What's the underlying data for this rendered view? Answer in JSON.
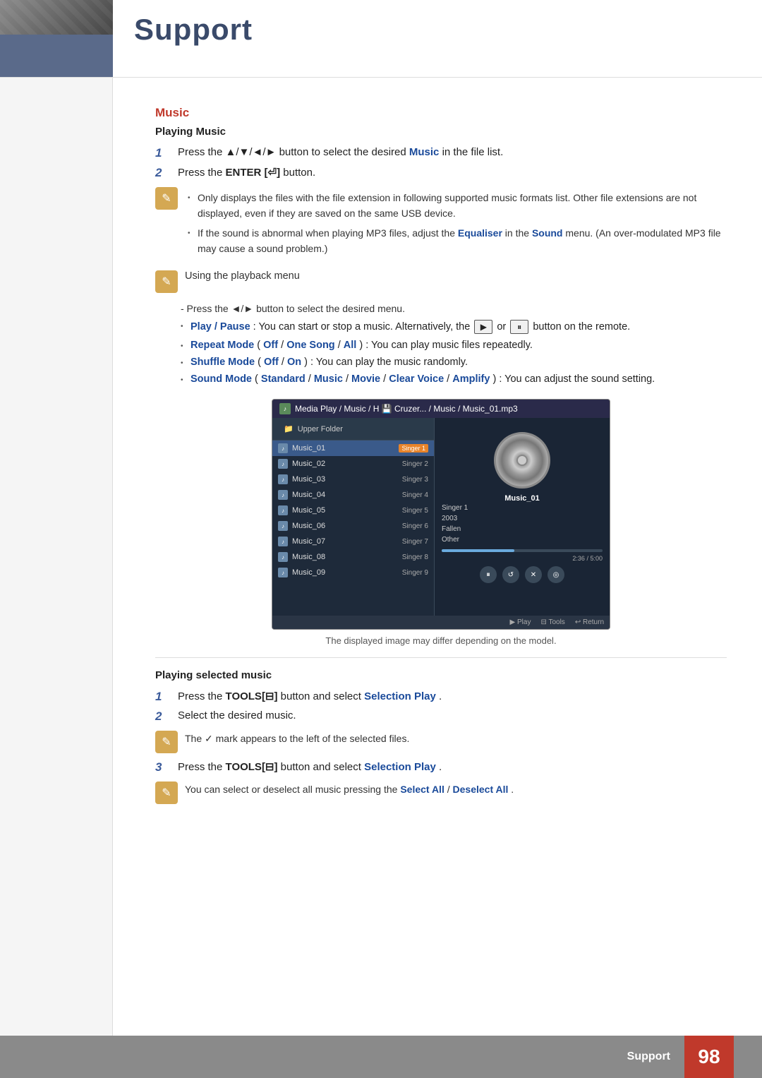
{
  "header": {
    "title": "Support"
  },
  "section": {
    "heading": "Music",
    "playing_music_heading": "Playing Music",
    "step1": "Press the ▲/▼/◄/► button to select the desired",
    "step1_bold": "Music",
    "step1_end": "in the file list.",
    "step2_start": "Press the",
    "step2_bold": "ENTER",
    "step2_end": "button.",
    "note1_bullet1": "Only displays the files with the file extension in following supported music formats list. Other file extensions are not displayed, even if they are saved on the same USB device.",
    "note1_bullet2_start": "If the sound is abnormal when playing MP3 files, adjust the",
    "note1_bullet2_eq": "Equaliser",
    "note1_bullet2_mid": "in the",
    "note1_bullet2_sound": "Sound",
    "note1_bullet2_end": "menu. (An over-modulated MP3 file may cause a sound problem.)",
    "playback_menu_label": "Using the playback menu",
    "press_lr_note": "- Press the ◄/► button to select the desired menu.",
    "play_pause_start": "Play / Pause",
    "play_pause_desc": ": You can start or stop a music. Alternatively, the",
    "play_pause_or": "or",
    "play_pause_end": "button on the remote.",
    "repeat_mode": "Repeat Mode",
    "repeat_off": "Off",
    "repeat_one": "One Song",
    "repeat_all": "All",
    "repeat_desc": ": You can play music files repeatedly.",
    "shuffle_mode": "Shuffle Mode",
    "shuffle_off": "Off",
    "shuffle_on": "On",
    "shuffle_desc": ": You can play the music randomly.",
    "sound_mode": "Sound Mode",
    "sound_standard": "Standard",
    "sound_music": "Music",
    "sound_movie": "Movie",
    "sound_clear": "Clear Voice",
    "sound_amplify": "Amplify",
    "sound_desc": ": You can adjust the sound setting.",
    "screenshot_titlebar": "Media Play / Music / H",
    "screenshot_titlebar2": "Cruzer... / Music / Music_01.mp3",
    "upper_folder": "Upper Folder",
    "files": [
      {
        "name": "Music_01",
        "singer": "Singer 1",
        "selected": true
      },
      {
        "name": "Music_02",
        "singer": "Singer 2",
        "selected": false
      },
      {
        "name": "Music_03",
        "singer": "Singer 3",
        "selected": false
      },
      {
        "name": "Music_04",
        "singer": "Singer 4",
        "selected": false
      },
      {
        "name": "Music_05",
        "singer": "Singer 5",
        "selected": false
      },
      {
        "name": "Music_06",
        "singer": "Singer 6",
        "selected": false
      },
      {
        "name": "Music_07",
        "singer": "Singer 7",
        "selected": false
      },
      {
        "name": "Music_08",
        "singer": "Singer 8",
        "selected": false
      },
      {
        "name": "Music_09",
        "singer": "Singer 9",
        "selected": false
      }
    ],
    "track_name": "Music_01",
    "track_singer": "Singer 1",
    "track_year": "2003",
    "track_album": "Fallen",
    "track_genre": "Other",
    "time_current": "2:36",
    "time_total": "5:00",
    "footer_play": "Play",
    "footer_tools": "Tools",
    "footer_return": "Return",
    "caption": "The displayed image may differ depending on the model.",
    "playing_selected_heading": "Playing selected music",
    "sel_step1_start": "Press the",
    "sel_step1_bold": "TOOLS[",
    "sel_step1_mid": "]",
    "sel_step1_end": "button and select",
    "sel_step1_select": "Selection Play",
    "sel_step1_dot": ".",
    "sel_step2": "Select the desired music.",
    "sel_note1": "The  ✓ mark appears to the left of the selected files.",
    "sel_step3_start": "Press the",
    "sel_step3_bold": "TOOLS[",
    "sel_step3_mid": "]",
    "sel_step3_end": "button and select",
    "sel_step3_select": "Selection Play",
    "sel_step3_dot": ".",
    "sel_note2_start": "You can select or deselect all music pressing the",
    "sel_note2_selectall": "Select All",
    "sel_note2_mid": "/",
    "sel_note2_deselectall": "Deselect All",
    "sel_note2_dot": "."
  },
  "footer": {
    "label": "Support",
    "page_number": "98"
  }
}
